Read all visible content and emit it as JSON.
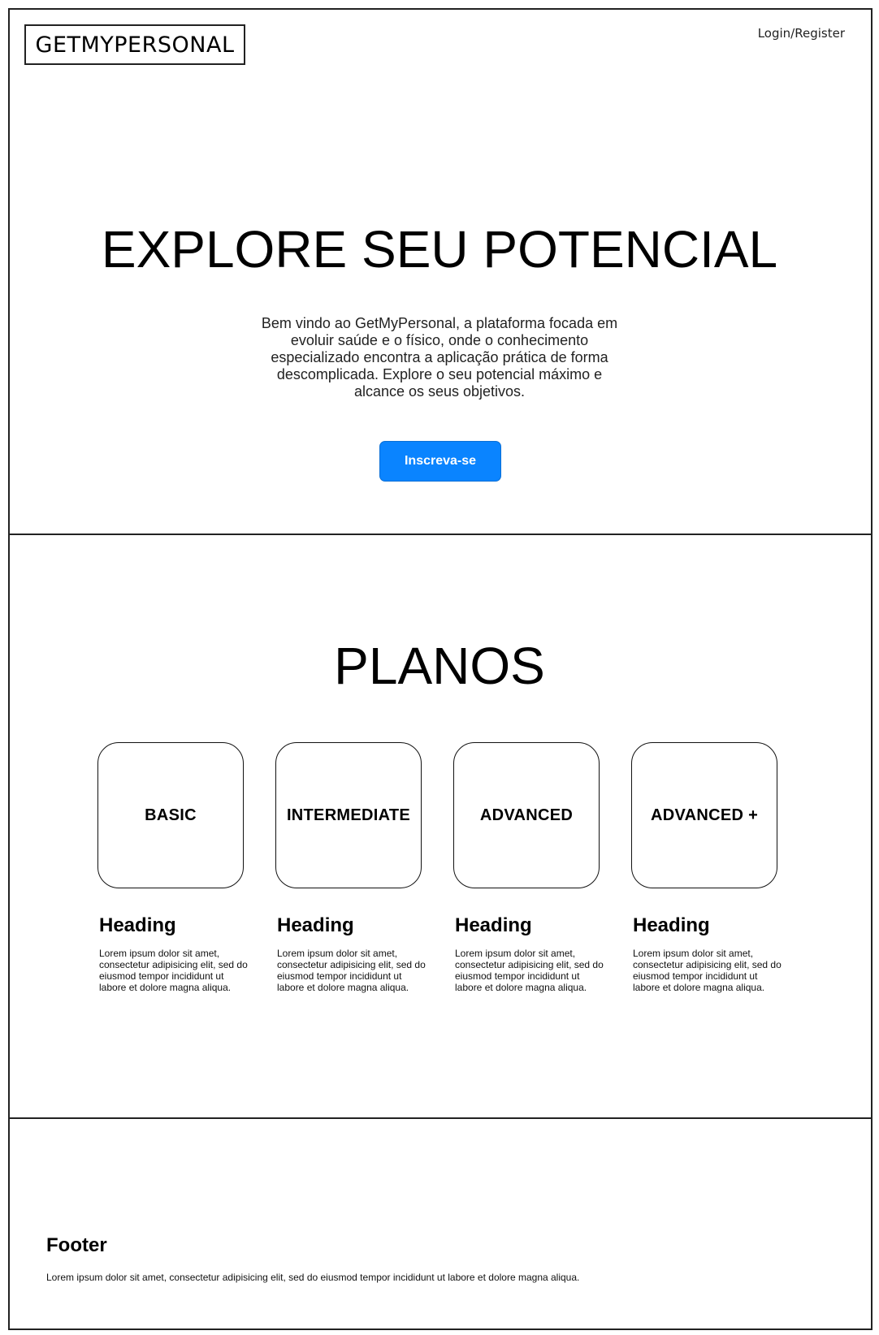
{
  "header": {
    "logo": "GETMYPERSONAL",
    "login_label": "Login/Register"
  },
  "hero": {
    "title": "EXPLORE SEU POTENCIAL",
    "description": "Bem vindo ao GetMyPersonal, a plataforma focada em evoluir saúde e o físico, onde o conhecimento especializado encontra a aplicação prática de forma descomplicada. Explore o seu potencial máximo e alcance os seus objetivos.",
    "cta_label": "Inscreva-se",
    "cta_color": "#0a84ff"
  },
  "plans": {
    "title": "PLANOS",
    "items": [
      {
        "label": "BASIC",
        "heading": "Heading",
        "text": "Lorem ipsum dolor sit amet, consectetur adipisicing elit, sed do eiusmod tempor incididunt ut labore et dolore magna aliqua."
      },
      {
        "label": "INTERMEDIATE",
        "heading": "Heading",
        "text": "Lorem ipsum dolor sit amet, consectetur adipisicing elit, sed do eiusmod tempor incididunt ut labore et dolore magna aliqua."
      },
      {
        "label": "ADVANCED",
        "heading": "Heading",
        "text": "Lorem ipsum dolor sit amet, consectetur adipisicing elit, sed do eiusmod tempor incididunt ut labore et dolore magna aliqua."
      },
      {
        "label": "ADVANCED +",
        "heading": "Heading",
        "text": "Lorem ipsum dolor sit amet, consectetur adipisicing elit, sed do eiusmod tempor incididunt ut labore et dolore magna aliqua."
      }
    ]
  },
  "footer": {
    "heading": "Footer",
    "text": "Lorem ipsum dolor sit amet, consectetur adipisicing elit, sed do eiusmod tempor incididunt ut labore et dolore magna aliqua."
  }
}
